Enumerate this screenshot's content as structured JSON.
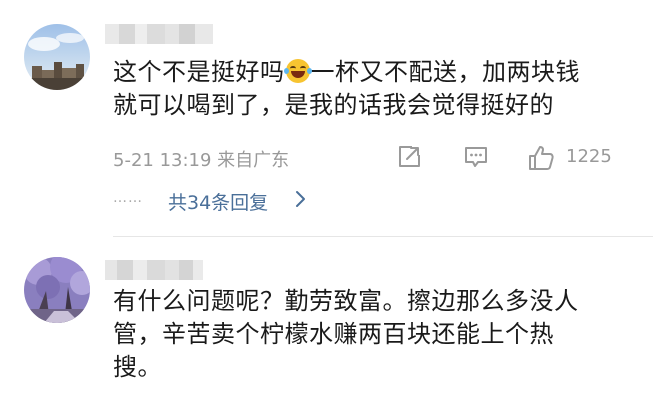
{
  "comments": [
    {
      "text_line1": "这个不是挺好吗",
      "emoji": "laugh-tears-emoji",
      "text_line1_rest": "一杯又不配送，加两块钱",
      "text_line2": "就可以喝到了，是我的话我会觉得挺好的",
      "time": "5-21 13:19 来自广东",
      "like_count": "1225",
      "replies_label": "共34条回复",
      "replies_dots": "……"
    },
    {
      "text_line1": "有什么问题呢？勤劳致富。擦边那么多没人",
      "text_line2": "管，辛苦卖个柠檬水赚两百块还能上个热",
      "text_line3": "搜。"
    }
  ],
  "colors": {
    "text": "#1a1a1a",
    "meta": "#999999",
    "link": "#4a6f99",
    "divider": "#e6e6e6"
  }
}
